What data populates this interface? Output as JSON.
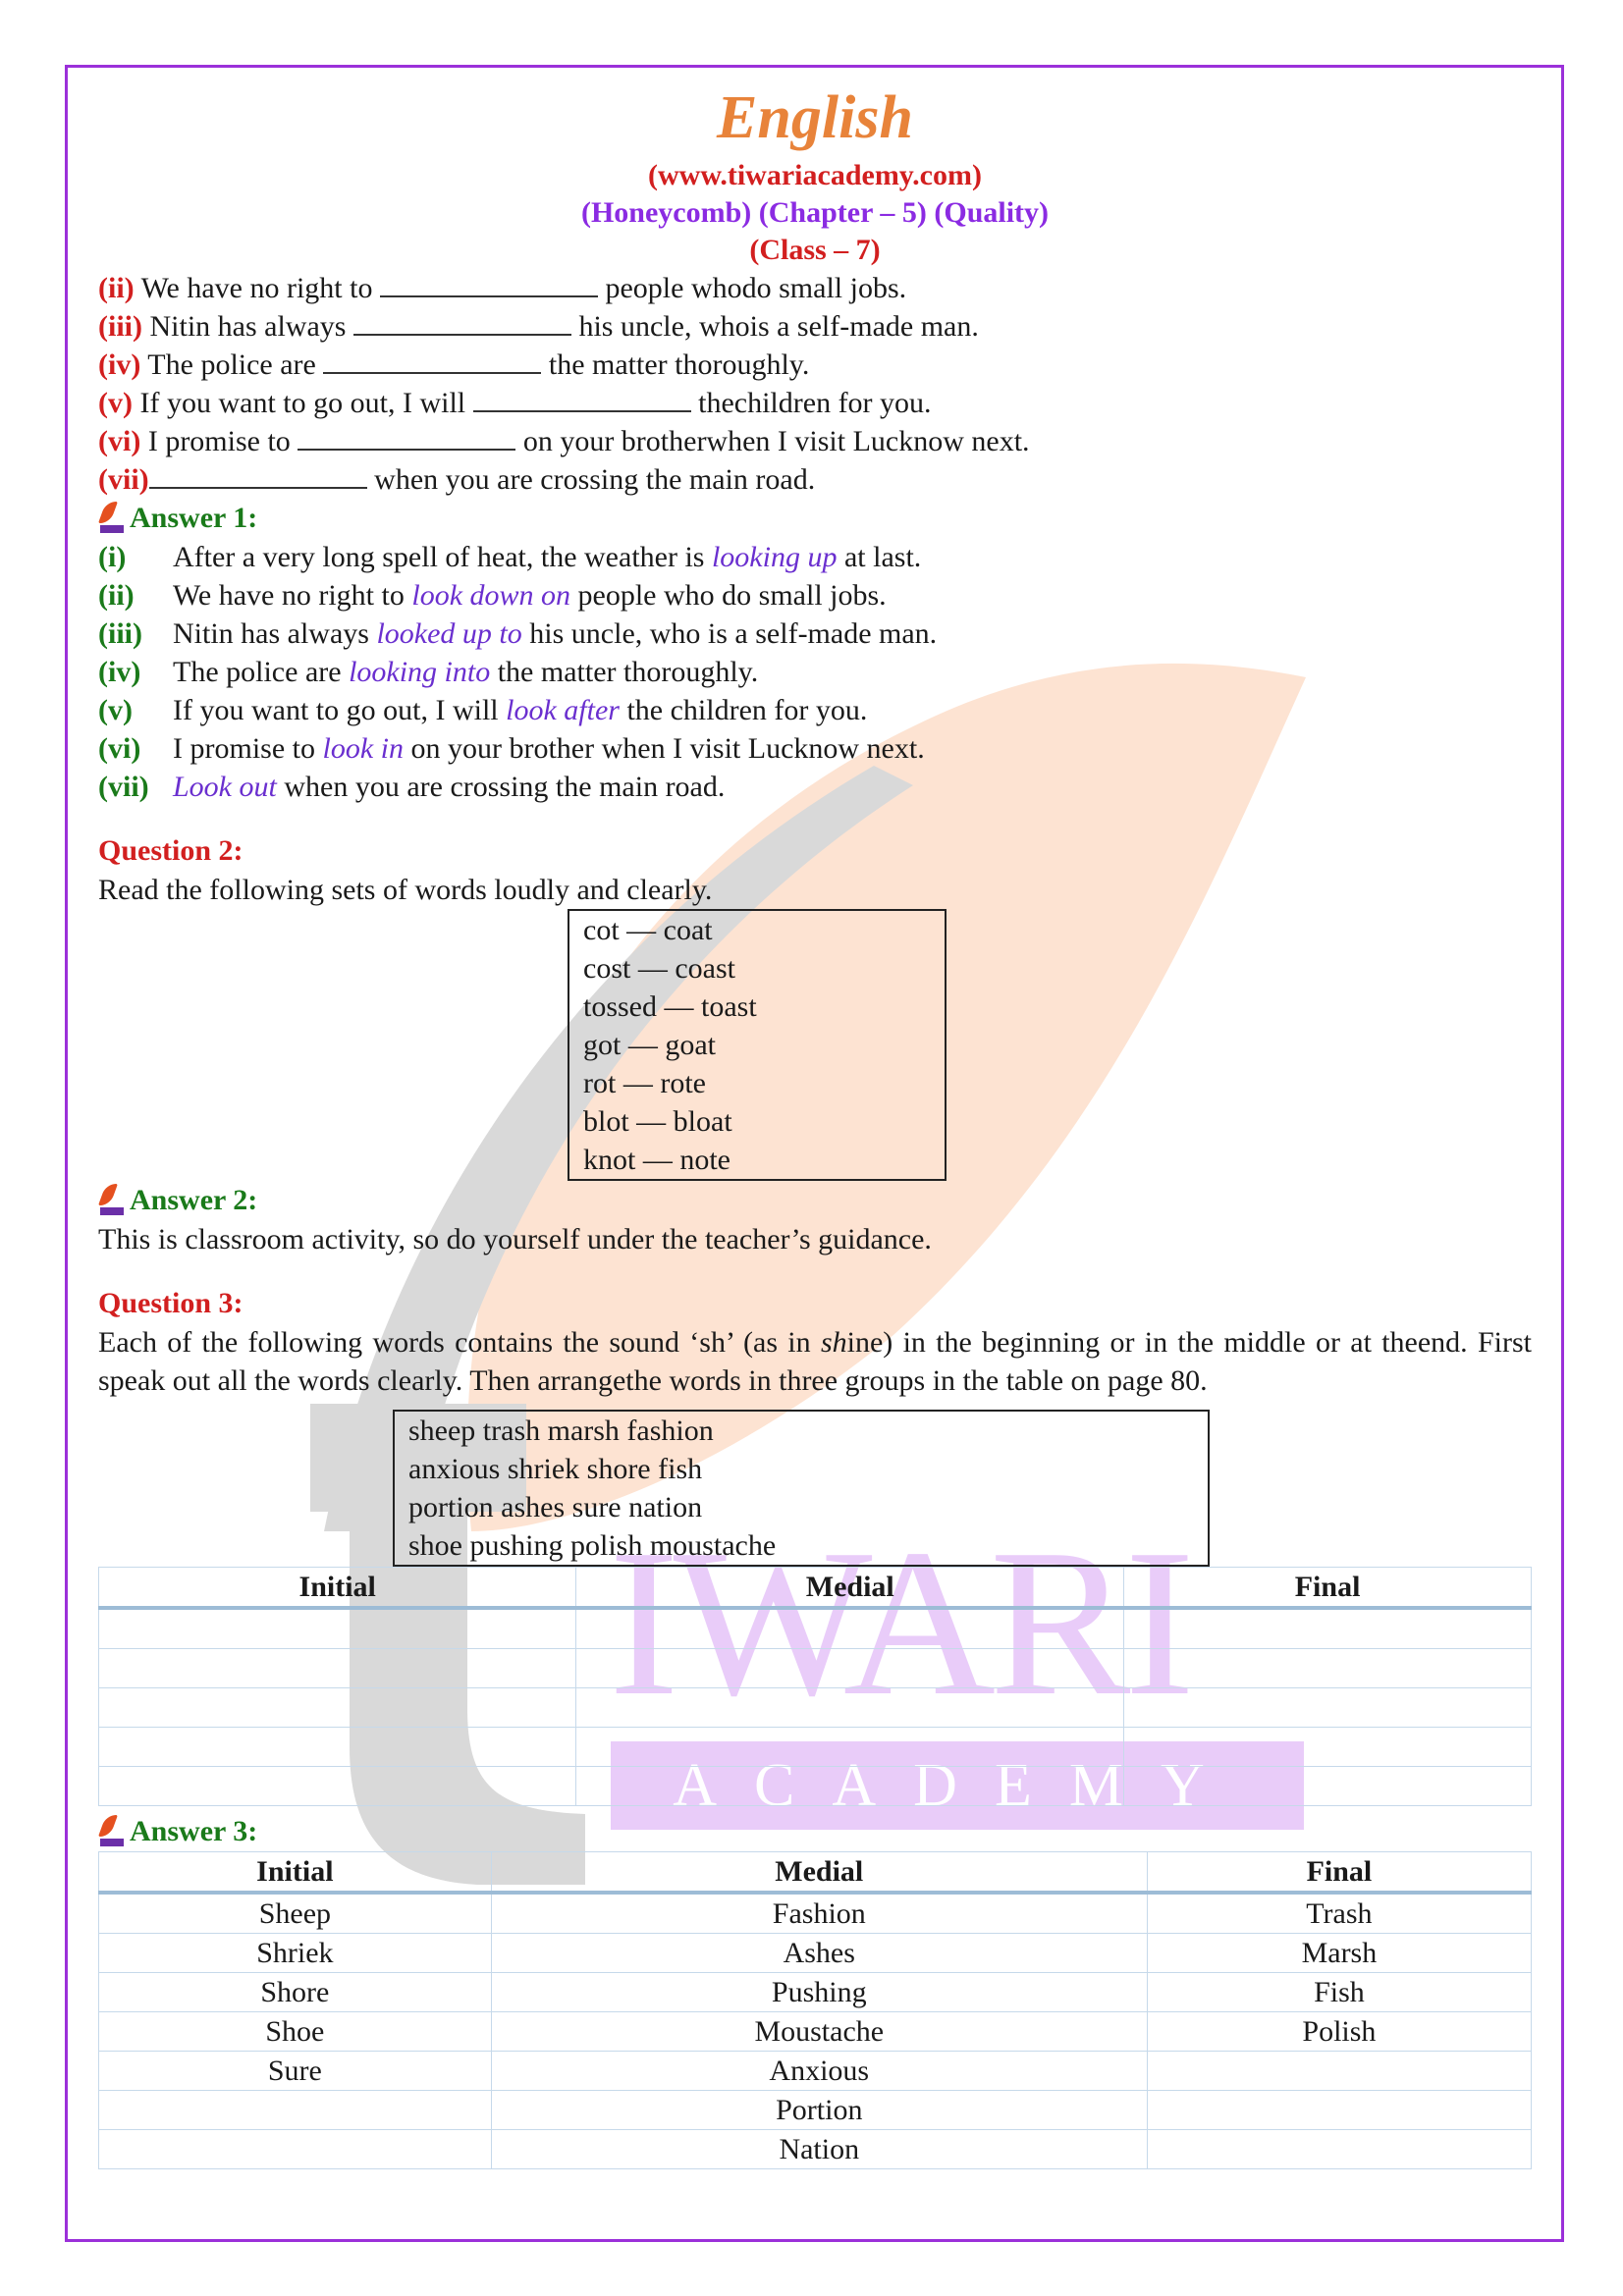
{
  "header": {
    "subject": "English",
    "website": "(www.tiwariacademy.com)",
    "chapter_line": "(Honeycomb) (Chapter – 5) (Quality)",
    "class_line": "(Class – 7)"
  },
  "colors": {
    "frame": "#9b30d9",
    "title": "#e8833a",
    "question_red": "#d21f1f",
    "answer_green": "#1a7a1a",
    "answer_word_purple": "#6a2fcf"
  },
  "question1_items": [
    {
      "num": "(ii)",
      "before": "We have no right to ",
      "after": " people whodo small jobs."
    },
    {
      "num": "(iii)",
      "before": "Nitin has always ",
      "after": " his uncle, whois a self-made man."
    },
    {
      "num": "(iv)",
      "before": "The police are ",
      "after": " the matter thoroughly."
    },
    {
      "num": "(v)",
      "before": "If you want to go out, I will ",
      "after": " thechildren for you."
    },
    {
      "num": "(vi)",
      "before": "I promise to ",
      "after": " on your brotherwhen I visit Lucknow next."
    },
    {
      "num": "(vii)",
      "before": "",
      "after": " when you are crossing the main road."
    }
  ],
  "answer1": {
    "heading": "Answer 1:",
    "items": [
      {
        "num": "(i)",
        "before": "After a very long spell of heat, the weather is ",
        "answer": "looking up",
        "after": " at last."
      },
      {
        "num": "(ii)",
        "before": "We have no right to ",
        "answer": "look down on",
        "after": " people who do small jobs."
      },
      {
        "num": "(iii)",
        "before": "Nitin has always ",
        "answer": "looked up to",
        "after": " his uncle, who is a self-made man."
      },
      {
        "num": "(iv)",
        "before": "The police are ",
        "answer": "looking into",
        "after": " the matter thoroughly."
      },
      {
        "num": "(v)",
        "before": "If you want to go out, I will ",
        "answer": "look after",
        "after": " the children for you."
      },
      {
        "num": "(vi)",
        "before": "I promise to ",
        "answer": "look in",
        "after": " on your brother when I visit Lucknow next."
      },
      {
        "num": "(vii)",
        "before": "",
        "answer": "Look out",
        "after": " when you are crossing the main road."
      }
    ]
  },
  "question2": {
    "heading": "Question 2:",
    "text": "Read the following sets of words loudly and clearly.",
    "word_pairs": [
      "cot — coat",
      "cost — coast",
      "tossed — toast",
      "got — goat",
      "rot — rote",
      "blot — bloat",
      "knot — note"
    ]
  },
  "answer2": {
    "heading": "Answer 2:",
    "text": "This is classroom activity, so do yourself under the teacher’s guidance."
  },
  "question3": {
    "heading": "Question 3:",
    "text_before_italic": "Each of the following words contains the sound ‘sh’ (as in ",
    "italic": "sh",
    "text_after_italic": "ine) in the beginning or in the middle or at theend. First speak out all the words clearly. Then arrangethe words in three groups in the table on page 80.",
    "word_lines": [
      "sheep trash marsh fashion",
      "anxious shriek shore fish",
      "portion ashes sure nation",
      "shoe pushing polish moustache"
    ],
    "table_headers": [
      "Initial",
      "Medial",
      "Final"
    ],
    "empty_rows": 5
  },
  "answer3": {
    "heading": "Answer 3:",
    "table_headers": [
      "Initial",
      "Medial",
      "Final"
    ],
    "rows": [
      [
        "Sheep",
        "Fashion",
        "Trash"
      ],
      [
        "Shriek",
        "Ashes",
        "Marsh"
      ],
      [
        "Shore",
        "Pushing",
        "Fish"
      ],
      [
        "Shoe",
        "Moustache",
        "Polish"
      ],
      [
        "Sure",
        "Anxious",
        ""
      ],
      [
        "",
        "Portion",
        ""
      ],
      [
        "",
        "Nation",
        ""
      ]
    ]
  },
  "watermark": {
    "word1": "IWARI",
    "word2": "ACADEMY"
  }
}
